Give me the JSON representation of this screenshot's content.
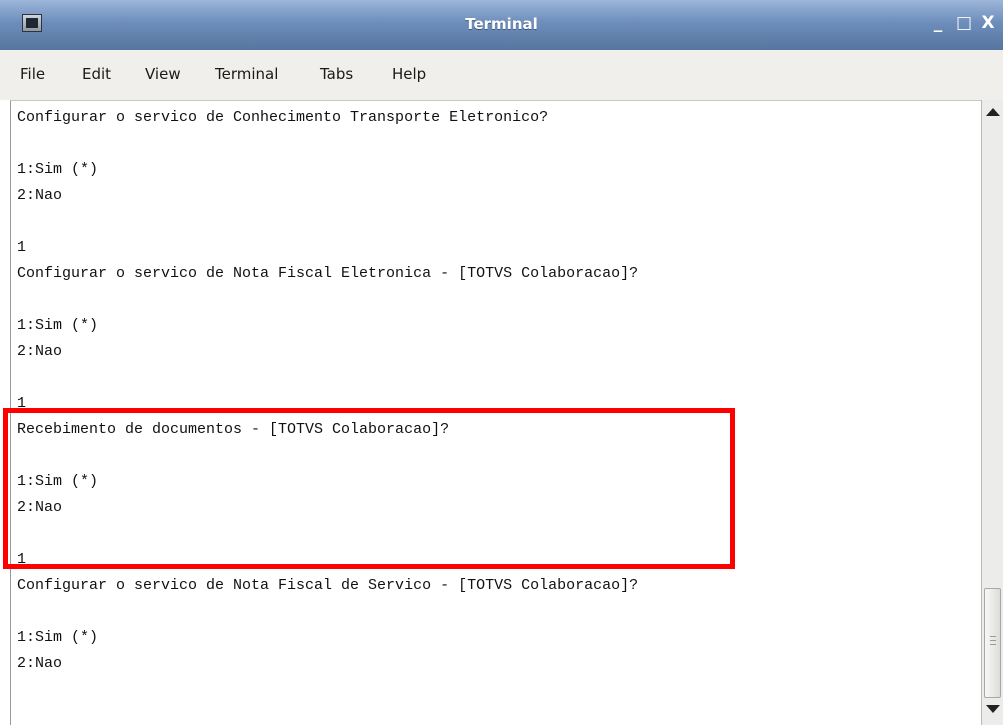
{
  "window": {
    "title": "Terminal",
    "controls": {
      "minimize": "_",
      "maximize": "□",
      "close": "X"
    }
  },
  "menu": [
    "File",
    "Edit",
    "View",
    "Terminal",
    "Tabs",
    "Help"
  ],
  "terminal_lines": [
    "Configurar o servico de Conhecimento Transporte Eletronico?",
    "",
    "1:Sim (*)",
    "2:Nao",
    "",
    "1",
    "Configurar o servico de Nota Fiscal Eletronica - [TOTVS Colaboracao]?",
    "",
    "1:Sim (*)",
    "2:Nao",
    "",
    "1",
    "Recebimento de documentos - [TOTVS Colaboracao]?",
    "",
    "1:Sim (*)",
    "2:Nao",
    "",
    "1",
    "Configurar o servico de Nota Fiscal de Servico - [TOTVS Colaboracao]?",
    "",
    "1:Sim (*)",
    "2:Nao"
  ],
  "colors": {
    "titlebar": "#6d8dbb",
    "menubar": "#f0efeb",
    "highlight": "#ff0000"
  },
  "icons": {
    "app": "terminal-icon",
    "scroll_up": "arrow-up-icon",
    "scroll_down": "arrow-down-icon"
  }
}
